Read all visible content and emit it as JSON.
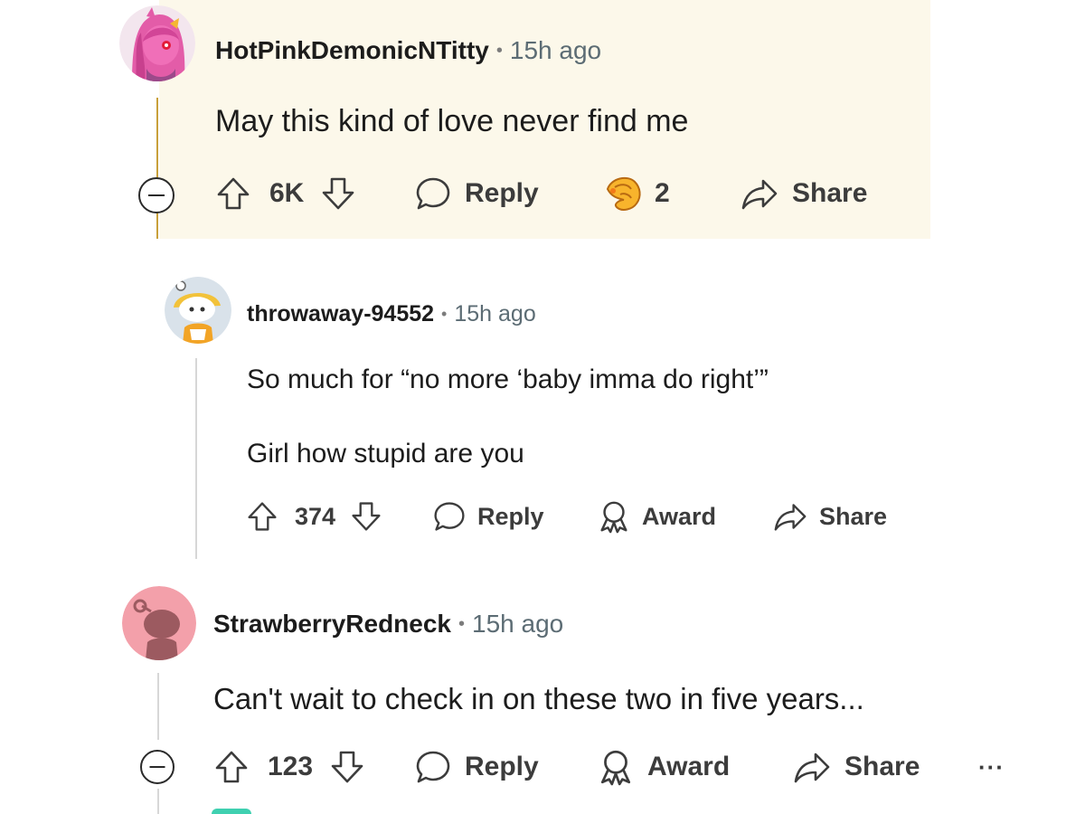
{
  "comments": [
    {
      "username": "HotPinkDemonicNTitty",
      "separator": "•",
      "time": "15h ago",
      "body": "May this kind of love never find me",
      "score": "6K",
      "reply_label": "Reply",
      "award_count": "2",
      "share_label": "Share"
    },
    {
      "username": "throwaway-94552",
      "separator": "•",
      "time": "15h ago",
      "body_lines": [
        "So much for “no more ‘baby imma do right’”",
        "Girl how stupid are you"
      ],
      "score": "374",
      "reply_label": "Reply",
      "award_label": "Award",
      "share_label": "Share"
    },
    {
      "username": "StrawberryRedneck",
      "separator": "•",
      "time": "15h ago",
      "body": "Can't wait to check in on these two in five years...",
      "score": "123",
      "reply_label": "Reply",
      "award_label": "Award",
      "share_label": "Share",
      "more_label": "···"
    }
  ],
  "icons": {
    "upvote": "upvote-icon",
    "downvote": "downvote-icon",
    "reply": "comment-bubble-icon",
    "award": "award-icon",
    "share": "share-arrow-icon",
    "collapse": "collapse-minus-icon",
    "more": "more-options-icon"
  },
  "colors": {
    "highlight_bg": "#fcf8ea",
    "thread_line": "#d7d7d7",
    "highlight_thread_line": "#c9a03a",
    "text": "#1c1c1c",
    "muted": "#5c6c74"
  }
}
